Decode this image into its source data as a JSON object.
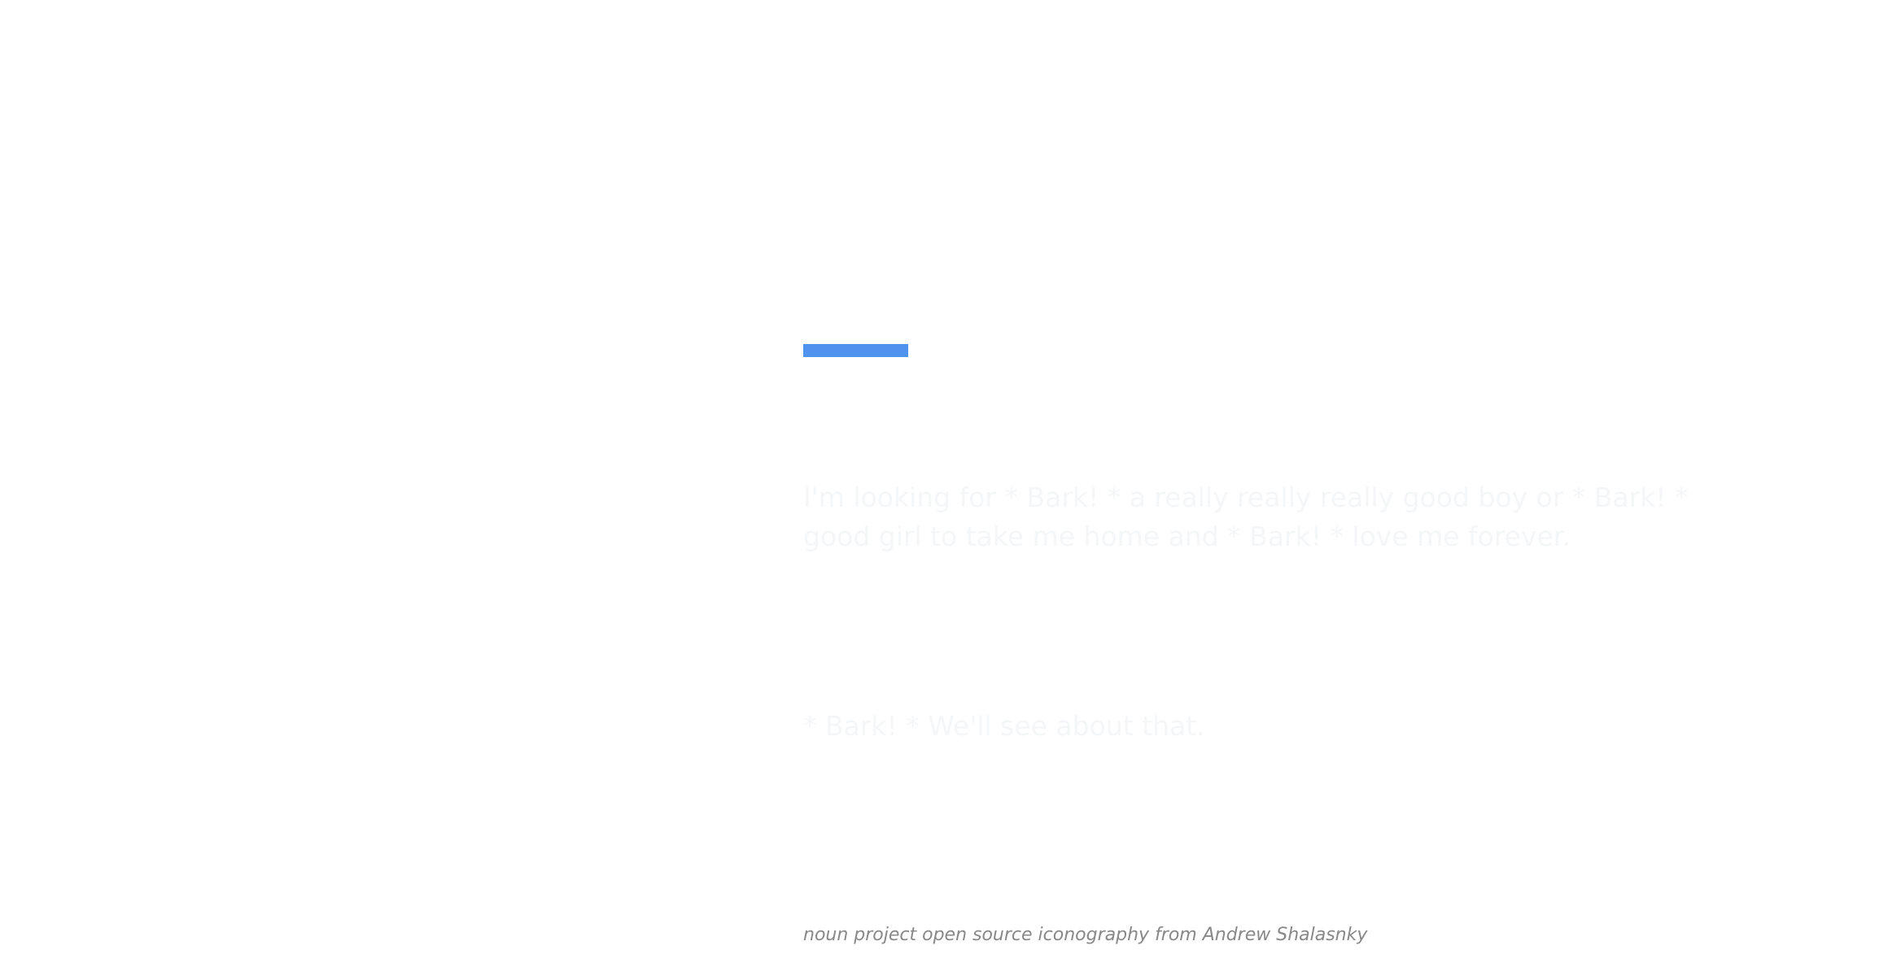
{
  "colors": {
    "background": "#ffffff",
    "accent": "#4f93ef",
    "faint_text": "#f4f6f8",
    "credit_text": "#888888"
  },
  "main": {
    "intro_text": "I'm looking for * Bark! * a really really really good boy or * Bark! * good girl to take me home and * Bark! * love me forever.",
    "reply_text": "* Bark! * We'll see about that."
  },
  "footer": {
    "credit": "noun project open source iconography from Andrew Shalasnky"
  }
}
